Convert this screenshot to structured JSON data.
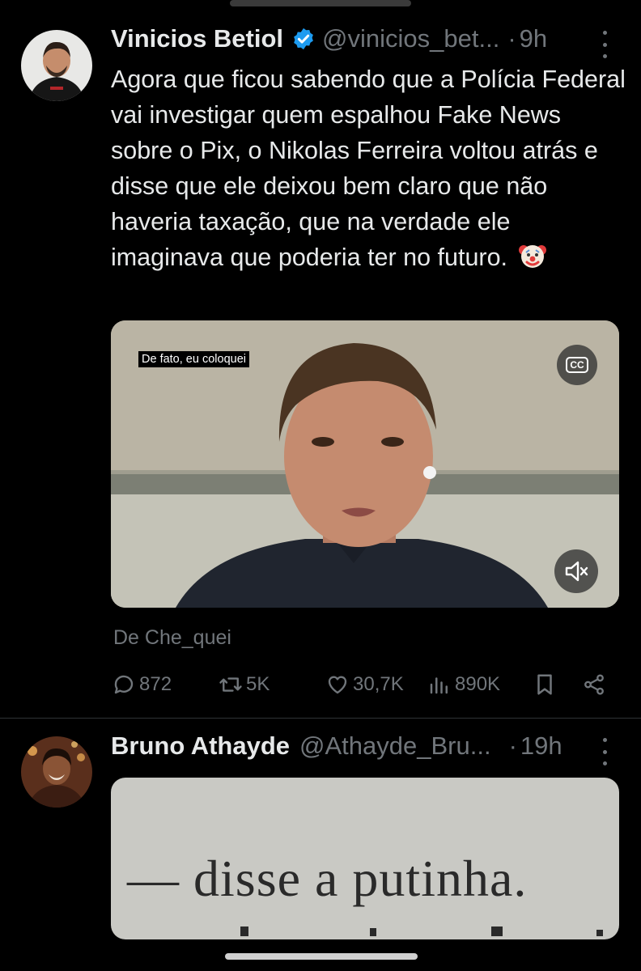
{
  "tweets": [
    {
      "author_name": "Vinicios Betiol",
      "handle": "@vinicios_bet...",
      "dot": "·",
      "time": "9h",
      "verified": true,
      "text": "Agora que ficou sabendo que a Polícia Federal vai investigar quem espalhou Fake News sobre o Pix, o Nikolas Ferreira voltou atrás e disse que ele deixou bem claro que não haveria taxação, que na verdade ele imaginava que poderia ter no futuro.",
      "emoji_icon": "clown-face-icon",
      "video": {
        "caption": "De fato, eu coloquei",
        "cc_label": "CC",
        "mute_icon": "speaker-muted-icon"
      },
      "attribution": "De Che_quei",
      "stats": {
        "replies": "872",
        "retweets": "5K",
        "likes": "30,7K",
        "views": "890K"
      }
    },
    {
      "author_name": "Bruno Athayde",
      "handle": "@Athayde_Bru...",
      "dot": "·",
      "time": "19h",
      "image_text": "— disse a putinha."
    }
  ],
  "icons": [
    "more-vertical-icon",
    "verified-badge-icon",
    "reply-icon",
    "retweet-icon",
    "like-icon",
    "views-icon",
    "bookmark-icon",
    "share-icon"
  ],
  "colors": {
    "background": "#000000",
    "text": "#e7e9ea",
    "secondary_text": "#71767b",
    "verified_blue": "#1d9bf0",
    "divider": "#2f3336"
  }
}
